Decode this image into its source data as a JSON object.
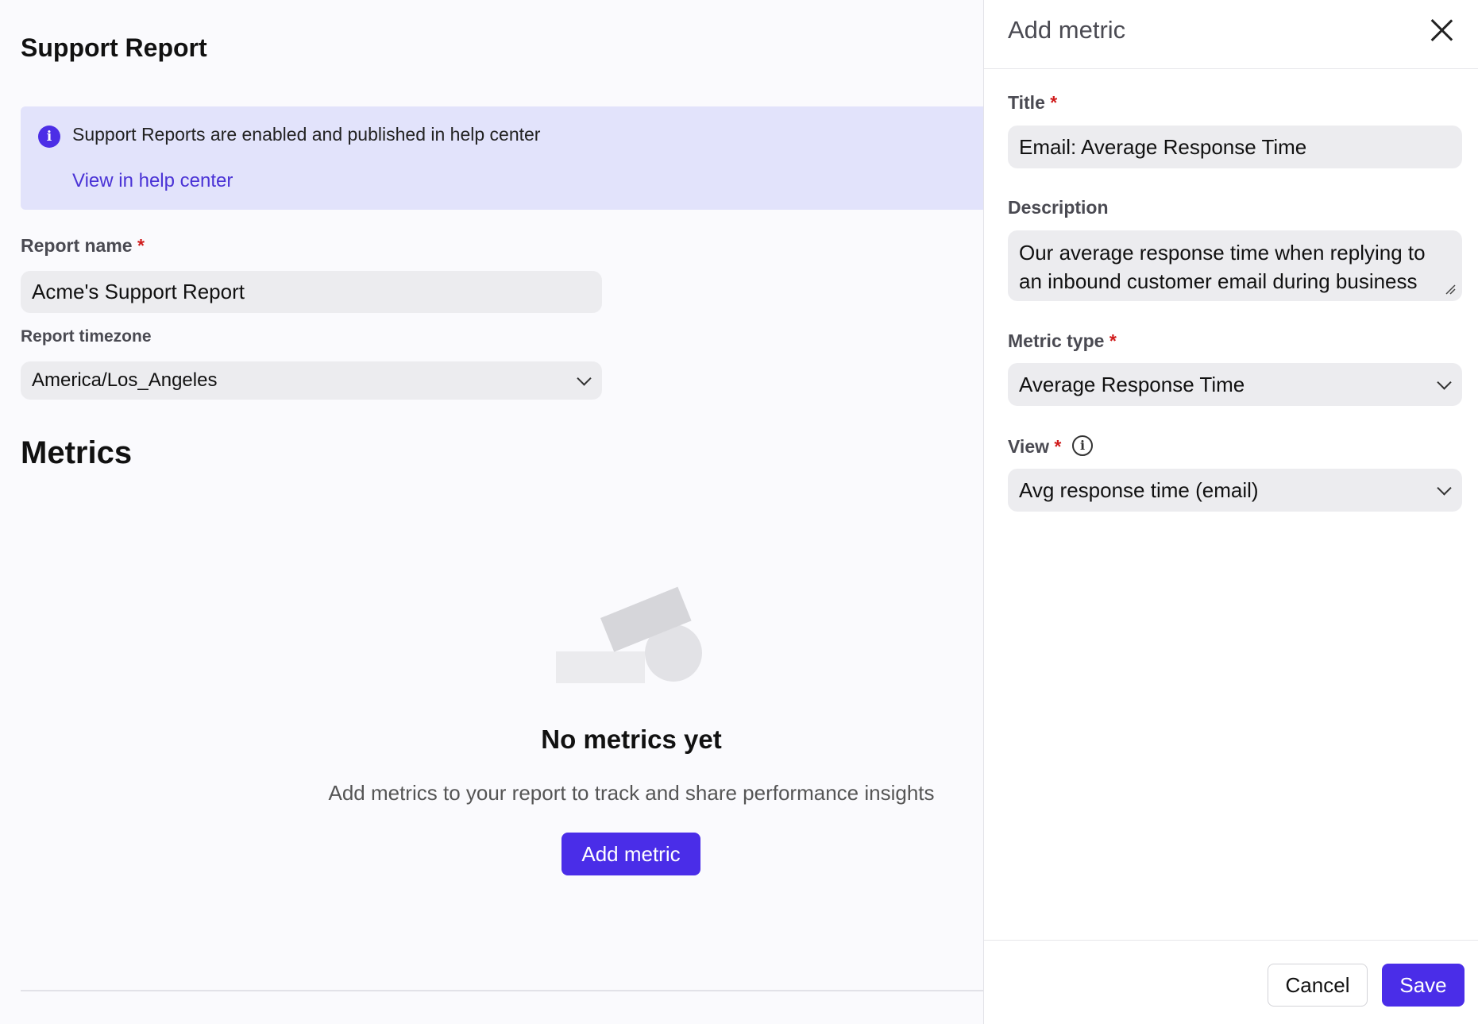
{
  "page": {
    "title": "Support Report",
    "banner": {
      "icon": "info-icon",
      "text": "Support Reports are enabled and published in help center",
      "link": "View in help center"
    },
    "report_name": {
      "label": "Report name",
      "required_mark": "*",
      "value": "Acme's Support Report"
    },
    "report_timezone": {
      "label": "Report timezone",
      "value": "America/Los_Angeles"
    },
    "metrics_title": "Metrics",
    "empty_state": {
      "title": "No metrics yet",
      "description": "Add metrics to your report to track and share performance insights",
      "button": "Add metric"
    }
  },
  "panel": {
    "title": "Add metric",
    "close_icon": "close-icon",
    "title_field": {
      "label": "Title",
      "required_mark": "*",
      "value": "Email: Average Response Time"
    },
    "description_field": {
      "label": "Description",
      "value": "Our average response time when replying to an inbound customer email during business"
    },
    "metric_type": {
      "label": "Metric type",
      "required_mark": "*",
      "value": "Average Response Time"
    },
    "view": {
      "label": "View",
      "required_mark": "*",
      "info_icon": "info-icon",
      "value": "Avg response time (email)"
    },
    "footer": {
      "cancel": "Cancel",
      "save": "Save"
    }
  },
  "colors": {
    "accent": "#4a2de8",
    "banner_bg": "#e2e3fb",
    "required": "#d01c1c",
    "field_bg": "#ececef"
  }
}
